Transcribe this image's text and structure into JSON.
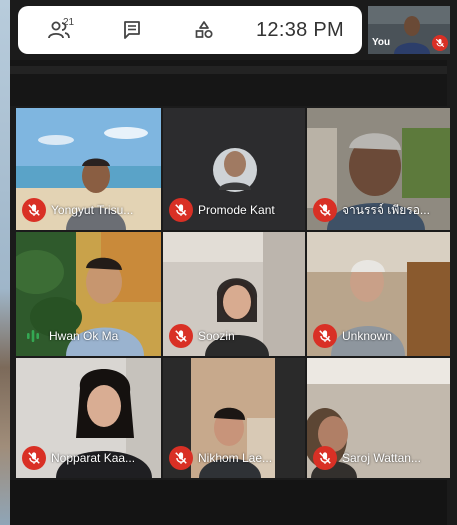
{
  "topbar": {
    "participants_count": "21",
    "time": "12:38 PM",
    "icons": [
      "participants-icon",
      "chat-icon",
      "shapes-icon"
    ]
  },
  "self_view": {
    "label": "You",
    "muted": true
  },
  "participants": [
    {
      "name": "Yongyut Trisu...",
      "mic": "muted"
    },
    {
      "name": "Promode Kant",
      "mic": "muted"
    },
    {
      "name": "จานรรจ์ เพียรอ...",
      "mic": "muted"
    },
    {
      "name": "Hwan Ok Ma",
      "mic": "speaking"
    },
    {
      "name": "Soozin",
      "mic": "muted"
    },
    {
      "name": "Unknown",
      "mic": "muted"
    },
    {
      "name": "Nopparat Kaa...",
      "mic": "muted"
    },
    {
      "name": "Nikhom Lae...",
      "mic": "muted"
    },
    {
      "name": "Saroj Wattan...",
      "mic": "muted"
    }
  ],
  "colors": {
    "muted_badge": "#d93025",
    "speaking": "#34a853",
    "background": "#1b1b1b"
  }
}
